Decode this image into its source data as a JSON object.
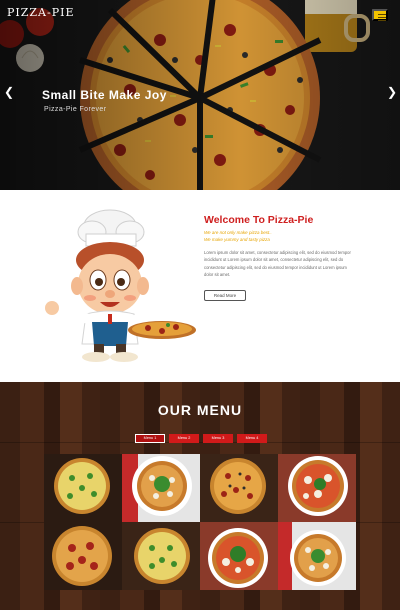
{
  "header": {
    "logo": "PIZZA-PIE",
    "menu_icon": "hamburger-icon",
    "menu_color": "#f2c300"
  },
  "hero": {
    "title": "Small Bite Make Joy",
    "subtitle": "Pizza-Pie Forever",
    "prev_icon": "chevron-left-icon",
    "next_icon": "chevron-right-icon"
  },
  "welcome": {
    "title": "Welcome To Pizza-Pie",
    "tagline1": "We are not only make pizza best..",
    "tagline2": "We make yummy and tasty pizza",
    "para1": "Lorem ipsum dolor sit amet, consectetur adipiscing elit, sed do eiusmod tempor incididunt ut Lorem ipsum dolor sit amet, consectetur adipiscing elit, sed do",
    "para2": "consectetur adipiscing elit, sed do eiusmod tempor incididunt ut Lorem ipsum dolor sit amet.",
    "read_more": "Read More",
    "accent": "#cf1f1f",
    "tag_color": "#e7a400"
  },
  "menu": {
    "title": "OUR MENU",
    "tabs": [
      "Menu 1",
      "Menu 2",
      "Menu 3",
      "Menu 4"
    ],
    "tab_color": "#d11a1a",
    "items": [
      "pizza-image-1",
      "pizza-image-2",
      "pizza-image-3",
      "pizza-image-4",
      "pizza-image-5",
      "pizza-image-6",
      "pizza-image-7",
      "pizza-image-8"
    ]
  }
}
